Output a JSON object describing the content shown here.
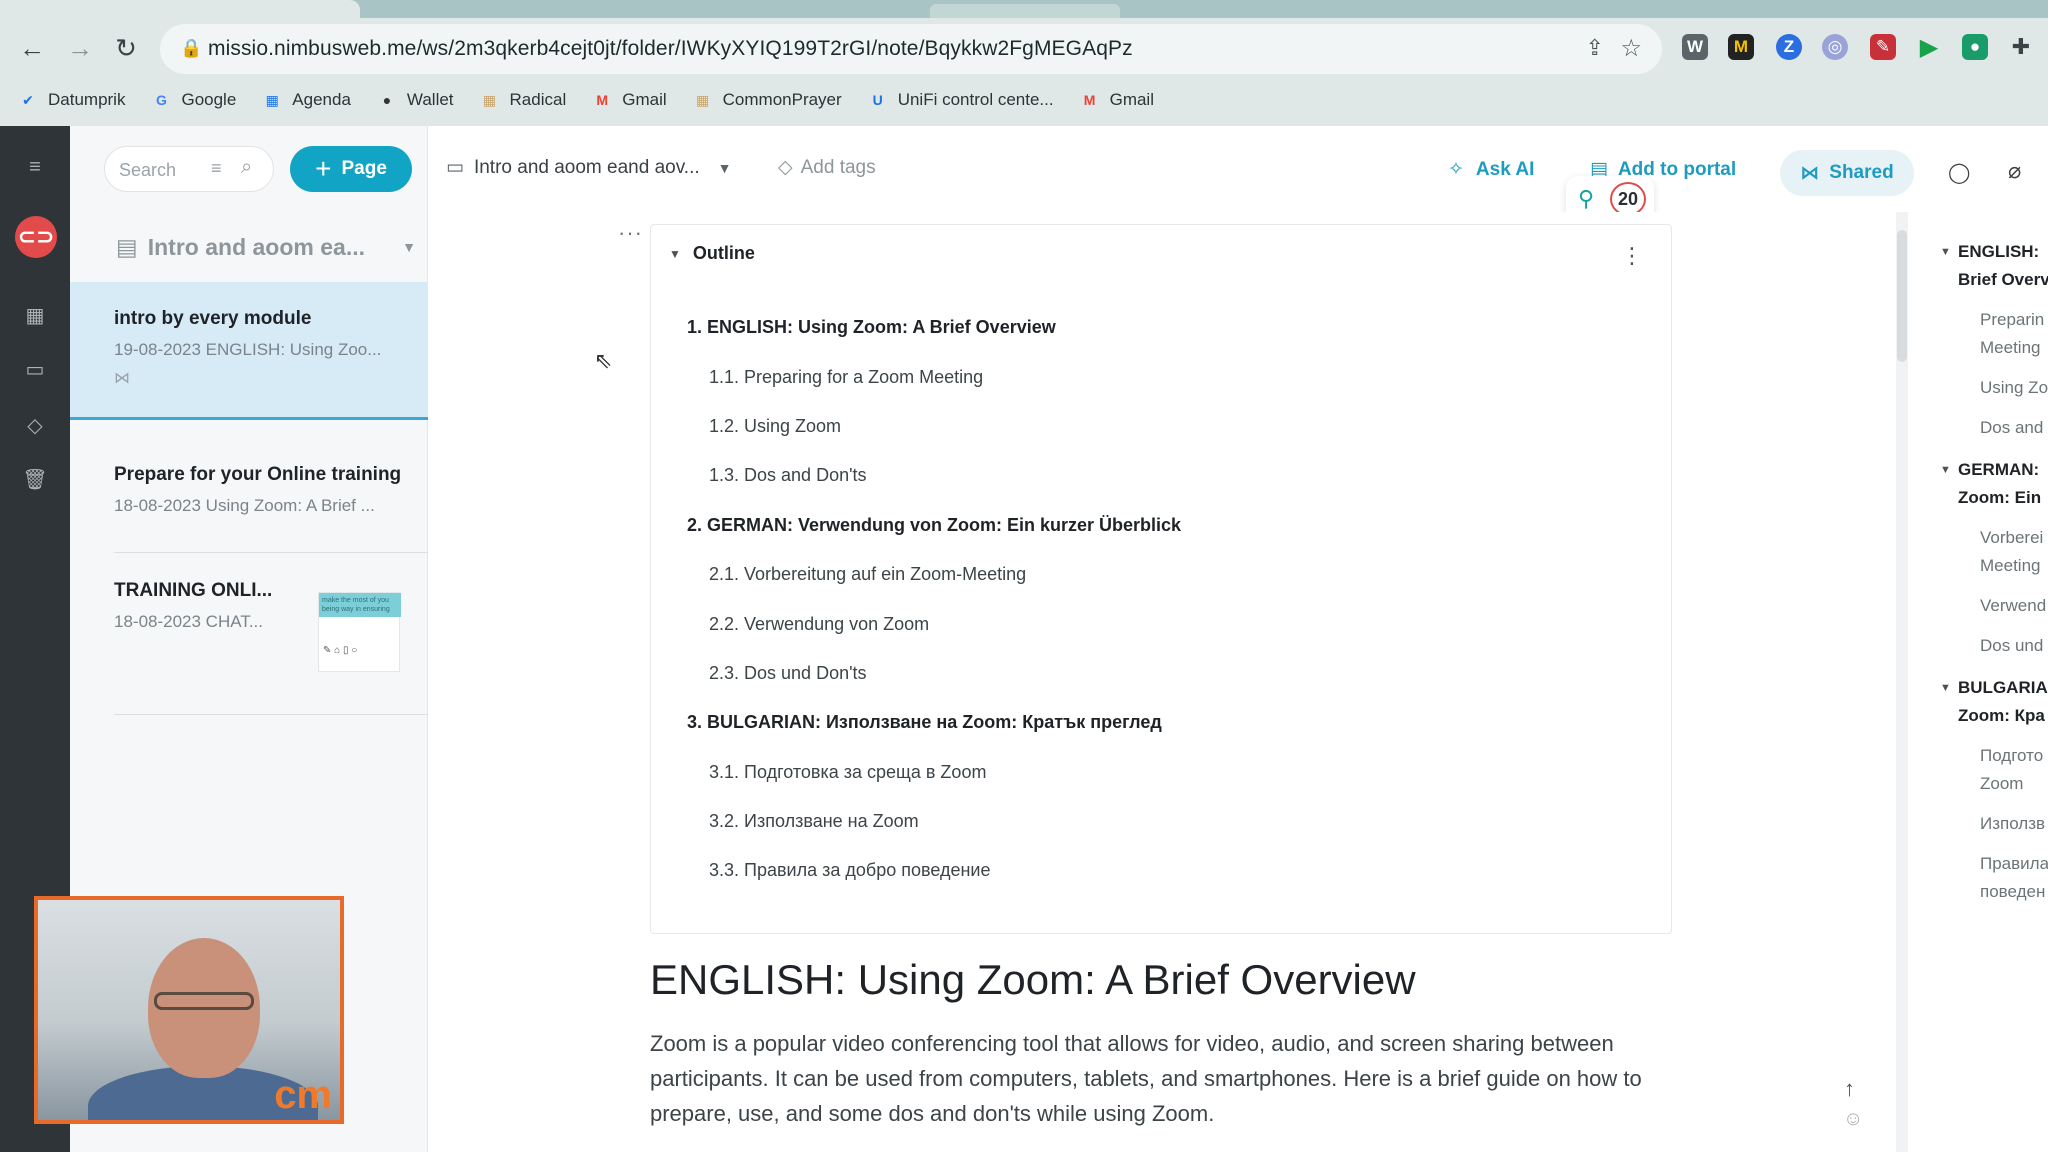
{
  "browser": {
    "url": "missio.nimbusweb.me/ws/2m3qkerb4cejt0jt/folder/IWKyXYIQ199T2rGI/note/Bqykkw2FgMEGAqPz",
    "bookmarks": [
      {
        "label": "Datumprik",
        "icon": "checkmark-icon",
        "color": "#1a73e8"
      },
      {
        "label": "Google",
        "icon": "google-icon",
        "color": "#4285f4"
      },
      {
        "label": "Agenda",
        "icon": "calendar-icon",
        "color": "#1a73e8"
      },
      {
        "label": "Wallet",
        "icon": "wallet-icon",
        "color": "#333333"
      },
      {
        "label": "Radical",
        "icon": "grid-icon",
        "color": "#c8a46a"
      },
      {
        "label": "Gmail",
        "icon": "gmail-icon",
        "color": "#ea4335"
      },
      {
        "label": "CommonPrayer",
        "icon": "grid-icon",
        "color": "#c8a46a"
      },
      {
        "label": "UniFi  control cente...",
        "icon": "unifi-icon",
        "color": "#1a73e8"
      },
      {
        "label": "Gmail",
        "icon": "gmail-icon",
        "color": "#ea4335"
      }
    ]
  },
  "sidebar": {
    "search_placeholder": "Search",
    "page_button": "Page",
    "folder_title": "Intro and aoom ea...",
    "notes": [
      {
        "title": "intro by every module",
        "subtitle": "19-08-2023 ENGLISH: Using Zoo..."
      },
      {
        "title": "Prepare for your Online training",
        "subtitle": "18-08-2023 Using Zoom: A Brief ..."
      },
      {
        "title": "TRAINING ONLI...",
        "subtitle": "18-08-2023 CHAT...",
        "thumb_text": "make the most of you being way in ensuring"
      }
    ]
  },
  "toolbar": {
    "breadcrumb": "Intro and aoom eand aov...",
    "add_tags": "Add tags",
    "ask_ai": "Ask AI",
    "add_to_portal": "Add to portal",
    "shared": "Shared",
    "badge_count": "20"
  },
  "outline": {
    "title": "Outline",
    "items": [
      {
        "level": 1,
        "text": "1. ENGLISH: Using Zoom: A Brief Overview"
      },
      {
        "level": 2,
        "text": "1.1. Preparing for a Zoom Meeting"
      },
      {
        "level": 2,
        "text": "1.2. Using Zoom"
      },
      {
        "level": 2,
        "text": "1.3. Dos and Don'ts"
      },
      {
        "level": 1,
        "text": "2. GERMAN: Verwendung von Zoom: Ein kurzer Überblick"
      },
      {
        "level": 2,
        "text": "2.1. Vorbereitung auf ein Zoom-Meeting"
      },
      {
        "level": 2,
        "text": "2.2. Verwendung von Zoom"
      },
      {
        "level": 2,
        "text": "2.3. Dos und Don'ts"
      },
      {
        "level": 1,
        "text": "3. BULGARIAN: Използване на Zoom: Кратък преглед"
      },
      {
        "level": 2,
        "text": "3.1. Подготовка за среща в Zoom"
      },
      {
        "level": 2,
        "text": "3.2. Използване на Zoom"
      },
      {
        "level": 2,
        "text": "3.3. Правила за добро поведение"
      }
    ]
  },
  "document": {
    "heading": "ENGLISH: Using Zoom: A Brief Overview",
    "paragraph": "Zoom is a popular video conferencing tool that allows for video, audio, and screen sharing between participants. It can be used from computers, tablets, and smartphones. Here is a brief guide on how to prepare, use, and some dos and don'ts while using Zoom."
  },
  "toc": {
    "lines": [
      {
        "kind": "h",
        "text": "ENGLISH:"
      },
      {
        "kind": "h",
        "text": "Brief Overv"
      },
      {
        "kind": "s",
        "text": "Preparin"
      },
      {
        "kind": "s",
        "text": "Meeting"
      },
      {
        "kind": "s",
        "text": "Using Zo"
      },
      {
        "kind": "s",
        "text": "Dos and"
      },
      {
        "kind": "h",
        "text": "GERMAN:"
      },
      {
        "kind": "h",
        "text": "Zoom: Ein"
      },
      {
        "kind": "s",
        "text": "Vorberei"
      },
      {
        "kind": "s",
        "text": "Meeting"
      },
      {
        "kind": "s",
        "text": "Verwend"
      },
      {
        "kind": "s",
        "text": "Dos und"
      },
      {
        "kind": "h",
        "text": "BULGARIA"
      },
      {
        "kind": "h",
        "text": "Zoom: Кра"
      },
      {
        "kind": "s",
        "text": "Подгото"
      },
      {
        "kind": "s",
        "text": "Zoom"
      },
      {
        "kind": "s",
        "text": "Използв"
      },
      {
        "kind": "s",
        "text": "Правила"
      },
      {
        "kind": "s",
        "text": "поведен"
      }
    ]
  },
  "webcam": {
    "watermark": "cm"
  },
  "colors": {
    "accent": "#12a4c4",
    "selected_note": "#d7ebf7",
    "rail": "#2e3437"
  }
}
